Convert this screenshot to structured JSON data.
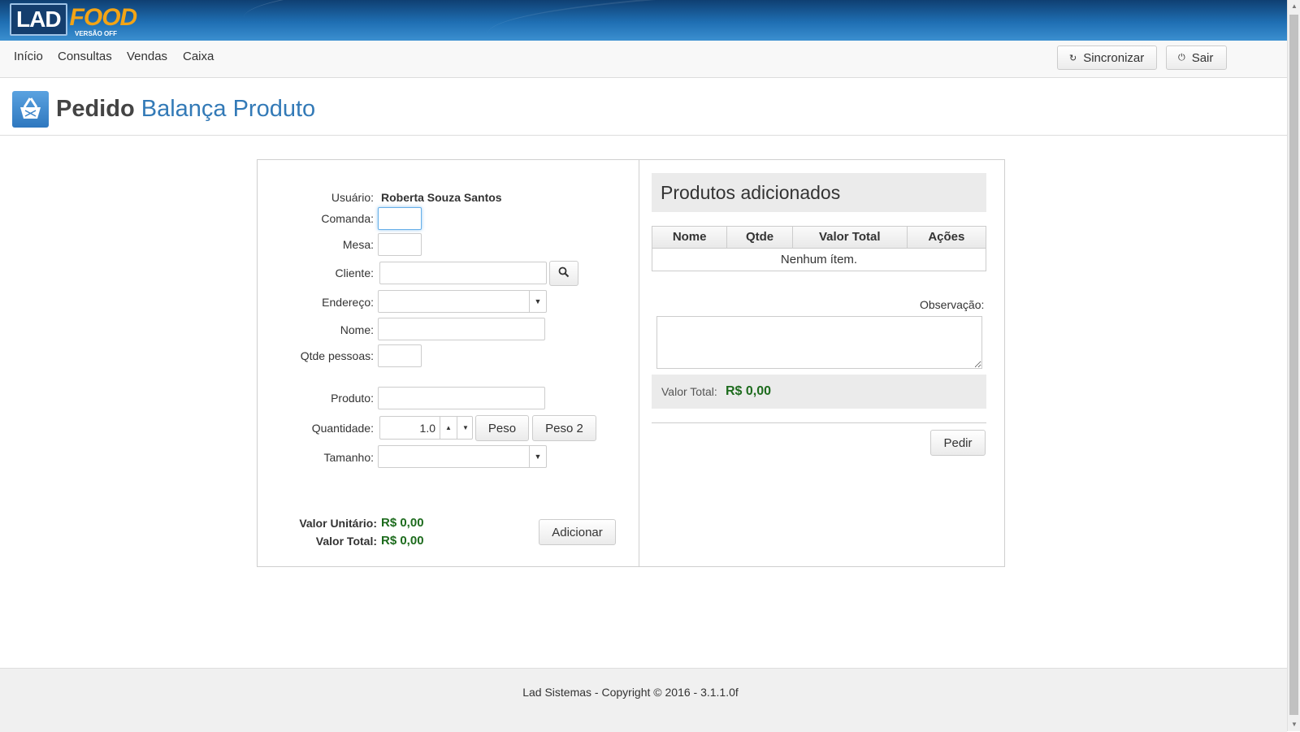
{
  "app": {
    "logo_lad": "LAD",
    "logo_food": "FOOD",
    "logo_sub": "VERSÃO OFF"
  },
  "nav": {
    "items": [
      "Início",
      "Consultas",
      "Vendas",
      "Caixa"
    ],
    "sync_label": "Sincronizar",
    "exit_label": "Sair"
  },
  "title": {
    "strong": "Pedido",
    "light": "Balança Produto"
  },
  "form": {
    "usuario_label": "Usuário:",
    "usuario_value": "Roberta Souza Santos",
    "comanda_label": "Comanda:",
    "mesa_label": "Mesa:",
    "cliente_label": "Cliente:",
    "endereco_label": "Endereço:",
    "nome_label": "Nome:",
    "qtde_pessoas_label": "Qtde pessoas:",
    "produto_label": "Produto:",
    "quantidade_label": "Quantidade:",
    "quantidade_value": "1.0",
    "peso_label": "Peso",
    "peso2_label": "Peso 2",
    "tamanho_label": "Tamanho:",
    "valor_unitario_label": "Valor Unitário:",
    "valor_unitario": "R$ 0,00",
    "valor_total_label": "Valor Total:",
    "valor_total": "R$ 0,00",
    "adicionar_label": "Adicionar"
  },
  "products": {
    "heading": "Produtos adicionados",
    "columns": [
      "Nome",
      "Qtde",
      "Valor Total",
      "Ações"
    ],
    "empty": "Nenhum ítem.",
    "observacao_label": "Observação:",
    "valor_total_label": "Valor Total:",
    "valor_total": "R$ 0,00",
    "pedir_label": "Pedir"
  },
  "footer": {
    "text": "Lad Sistemas - Copyright © 2016 - 3.1.1.0f"
  },
  "colors": {
    "accent": "#337ab7",
    "money": "#1d6b1d",
    "brand_orange": "#f3a415"
  }
}
